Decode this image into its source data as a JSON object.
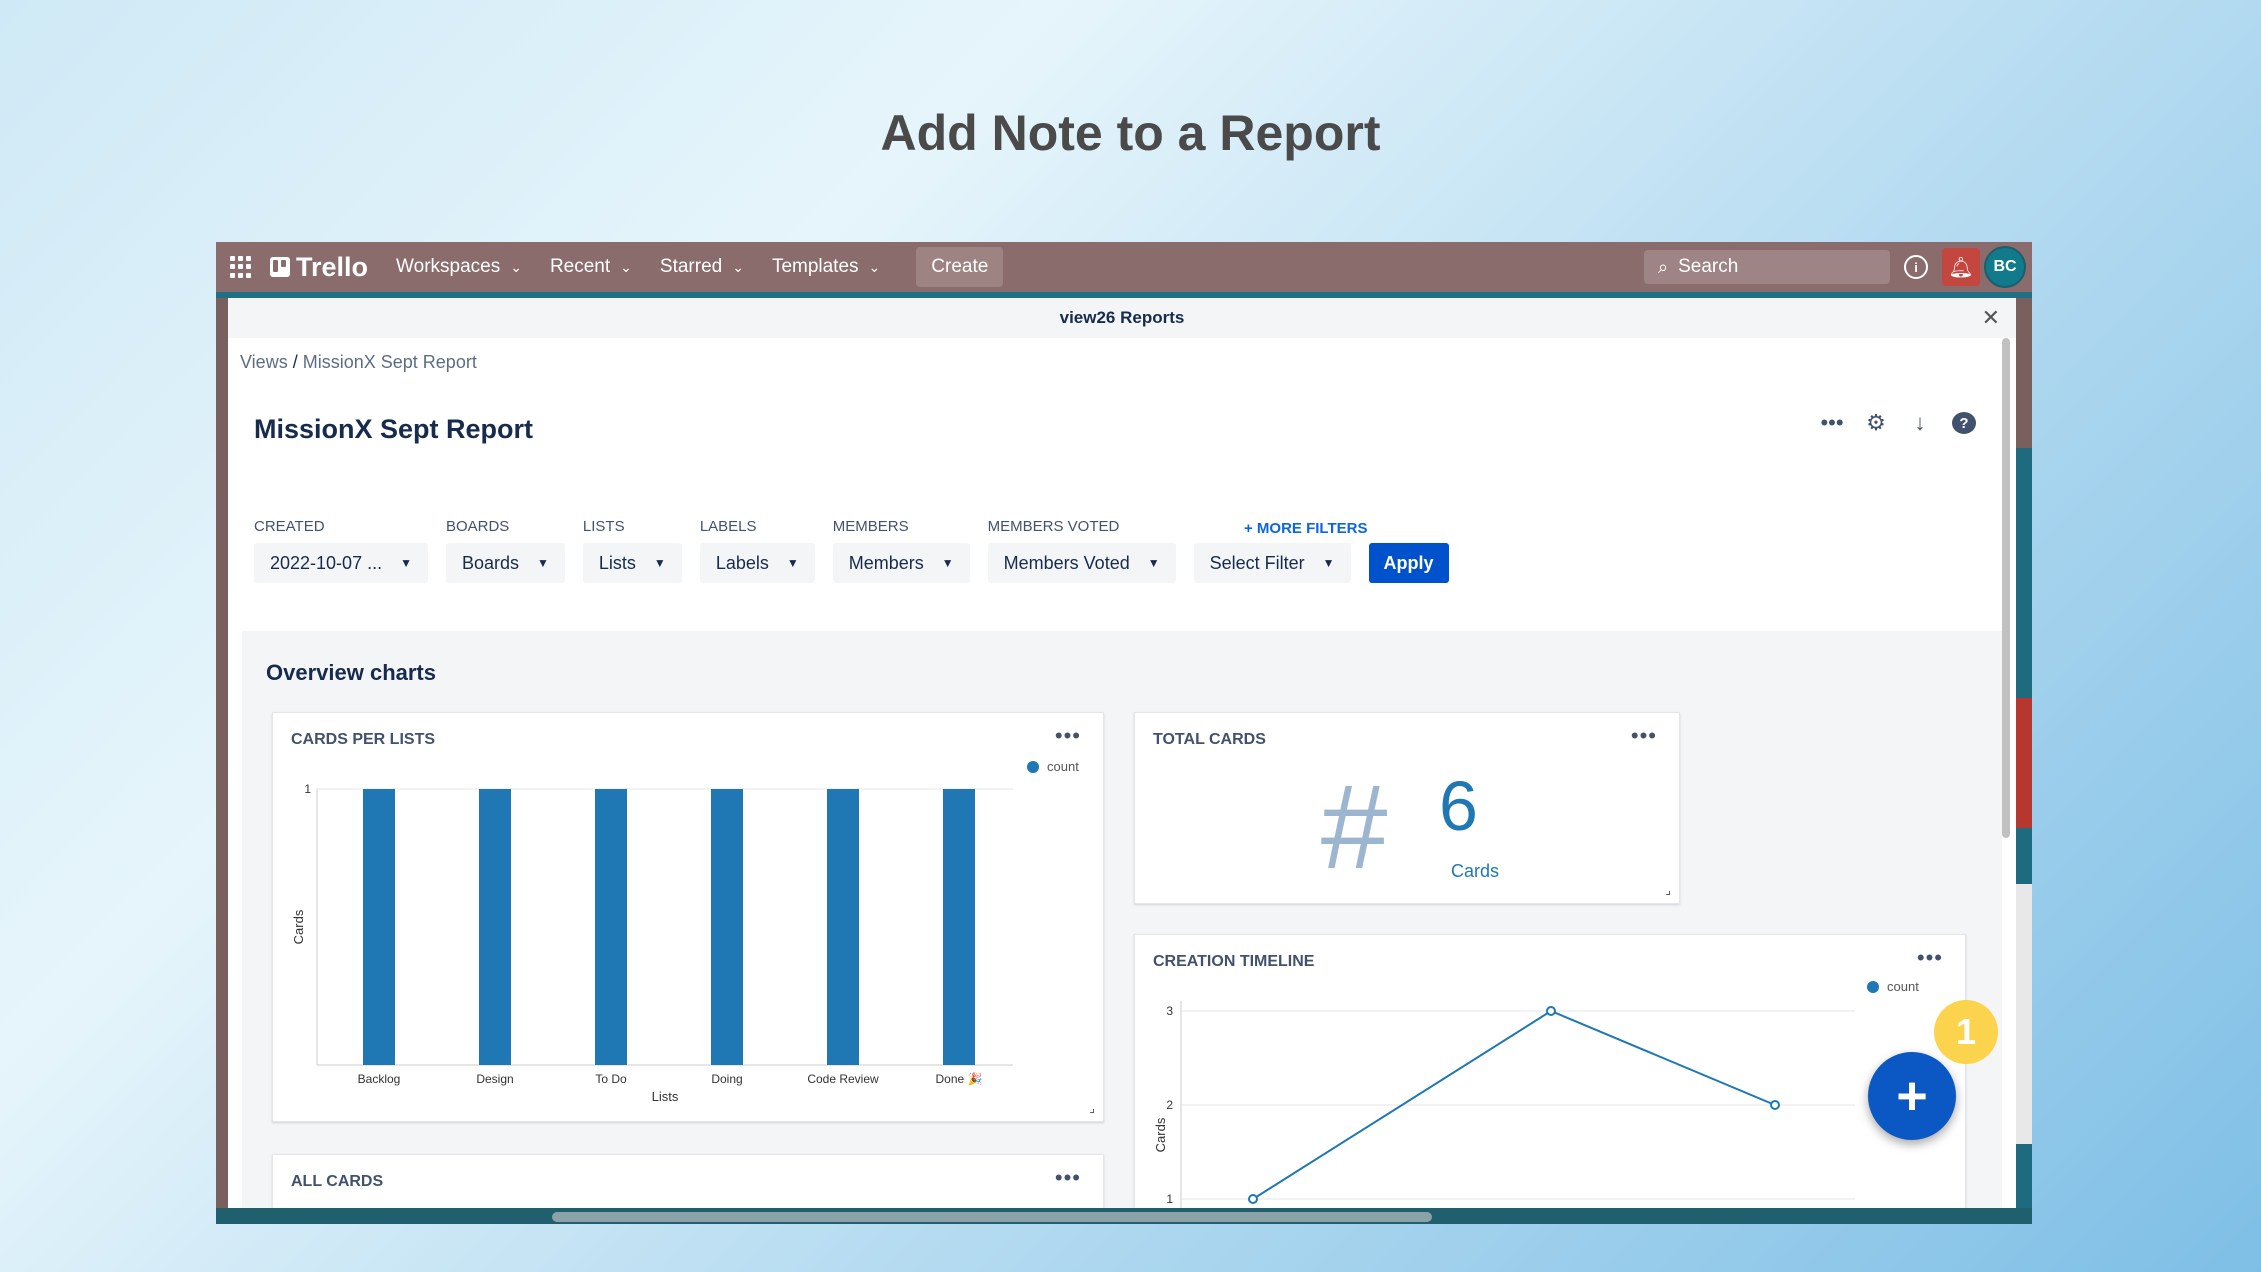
{
  "slide": {
    "title": "Add Note to a Report"
  },
  "topnav": {
    "logo": "Trello",
    "items": [
      {
        "label": "Workspaces"
      },
      {
        "label": "Recent"
      },
      {
        "label": "Starred"
      },
      {
        "label": "Templates"
      }
    ],
    "create_label": "Create",
    "search_placeholder": "Search",
    "avatar_initials": "BC"
  },
  "modal": {
    "title": "view26 Reports",
    "breadcrumb": {
      "root": "Views",
      "sep": "/",
      "current": "MissionX Sept Report"
    },
    "report_title": "MissionX Sept Report",
    "filters": [
      {
        "label": "CREATED",
        "value": "2022-10-07 ..."
      },
      {
        "label": "BOARDS",
        "value": "Boards"
      },
      {
        "label": "LISTS",
        "value": "Lists"
      },
      {
        "label": "LABELS",
        "value": "Labels"
      },
      {
        "label": "MEMBERS",
        "value": "Members"
      },
      {
        "label": "MEMBERS VOTED",
        "value": "Members Voted"
      },
      {
        "label": "",
        "value": "Select Filter"
      }
    ],
    "more_filters": "+ MORE FILTERS",
    "apply_label": "Apply",
    "overview_title": "Overview charts",
    "cards": {
      "cards_per_lists": "CARDS PER LISTS",
      "total_cards": "TOTAL CARDS",
      "creation_timeline": "CREATION TIMELINE",
      "all_cards": "ALL CARDS"
    },
    "total": {
      "symbol": "#",
      "value": "6",
      "unit": "Cards"
    }
  },
  "step_badge": "1",
  "colors": {
    "series": "#1f77b4",
    "accent": "#0052cc",
    "badge": "#fcd34d"
  },
  "chart_data": [
    {
      "type": "bar",
      "title": "CARDS PER LISTS",
      "categories": [
        "Backlog",
        "Design",
        "To Do",
        "Doing",
        "Code Review",
        "Done 🎉"
      ],
      "series": [
        {
          "name": "count",
          "values": [
            1,
            1,
            1,
            1,
            1,
            1
          ]
        }
      ],
      "xlabel": "Lists",
      "ylabel": "Cards",
      "yticks": [
        "1"
      ],
      "ylim": [
        0,
        1
      ],
      "legend": "top-right"
    },
    {
      "type": "line",
      "title": "CREATION TIMELINE",
      "series": [
        {
          "name": "count",
          "values": [
            1,
            3,
            2
          ]
        }
      ],
      "ylabel": "Cards",
      "yticks": [
        "1",
        "2",
        "3"
      ],
      "ylim": [
        1,
        3
      ],
      "legend": "top-right"
    }
  ]
}
